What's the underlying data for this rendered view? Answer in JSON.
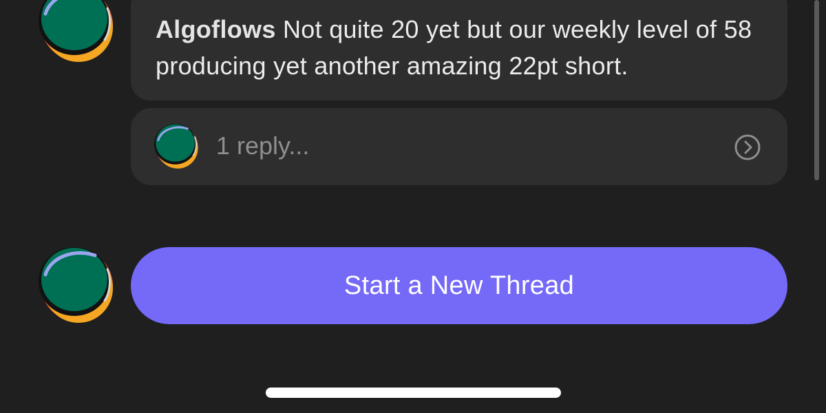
{
  "thread": {
    "message": {
      "author": "Algoflows",
      "text": "Not quite 20 yet but our weekly level of 58 producing yet another amazing 22pt short."
    },
    "replies": {
      "label": "1 reply..."
    }
  },
  "composer": {
    "new_thread_label": "Start a New Thread"
  },
  "icons": {
    "avatar": "algoflows-avatar-icon",
    "reply_arrow": "chevron-right-circle-icon"
  },
  "colors": {
    "background": "#1f1f1f",
    "bubble": "#2e2e2e",
    "accent": "#7569f8",
    "avatar_green": "#007055",
    "avatar_orange": "#f5a623",
    "muted_text": "#8f8f8f"
  }
}
